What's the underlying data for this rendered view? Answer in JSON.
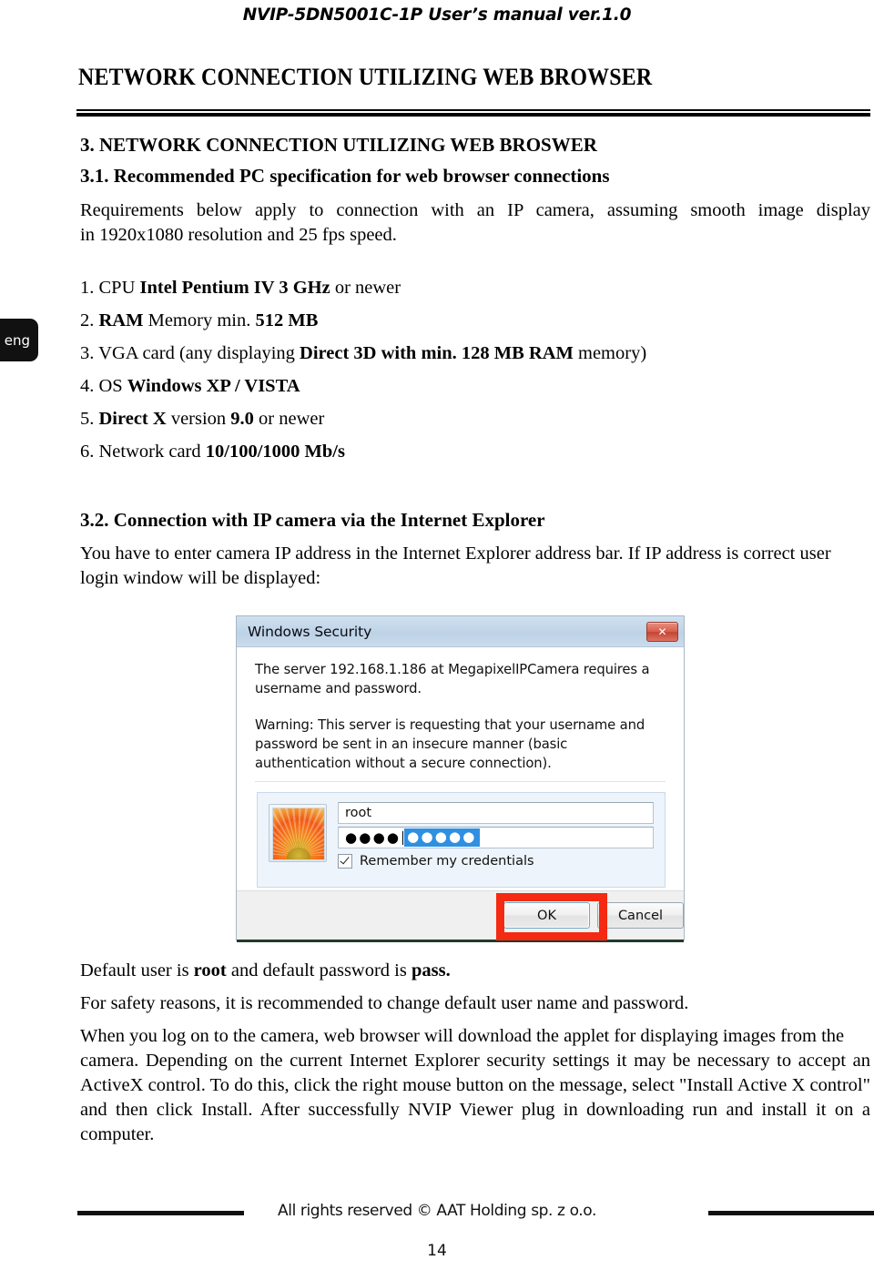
{
  "header": {
    "running_title": "NVIP-5DN5001C-1P User’s manual ver.1.0"
  },
  "chapter": {
    "title": "NETWORK CONNECTION UTILIZING WEB BROWSER"
  },
  "side_tab": {
    "label": "eng"
  },
  "sections": {
    "s3_heading": "3. NETWORK CONNECTION UTILIZING WEB BROSWER",
    "s31_heading": "3.1. Recommended PC specification for web browser connections",
    "s31_intro_1": "Requirements below apply to connection with an IP camera, assuming smooth image display",
    "s31_intro_2": "in  1920x1080 resolution and 25 fps speed.",
    "s32_heading": "3.2. Connection with IP camera via the Internet Explorer",
    "s32_intro_1": "You have to enter camera IP address in the Internet Explorer address bar. If IP address is correct user",
    "s32_intro_2": "login window will be displayed:"
  },
  "requirements": [
    {
      "num": "1.",
      "pre": "CPU ",
      "bold": "Intel Pentium IV 3 GHz",
      "post": " or newer"
    },
    {
      "num": "2.",
      "pre": "",
      "bold": "RAM",
      "mid": " Memory min. ",
      "bold2": "512 MB",
      "post": ""
    },
    {
      "num": "3.",
      "pre": "VGA card (any displaying ",
      "bold": "Direct 3D with min. 128 MB RAM",
      "post": " memory)"
    },
    {
      "num": "4.",
      "pre": "OS ",
      "bold": "Windows XP / VISTA",
      "post": ""
    },
    {
      "num": "5.",
      "pre": "",
      "bold": "Direct X",
      "mid": " version ",
      "bold2": "9.0",
      "post": " or newer"
    },
    {
      "num": "6.",
      "pre": "Network card ",
      "bold": "10/100/1000 Mb/s",
      "post": ""
    }
  ],
  "dialog": {
    "title": "Windows Security",
    "close_label": "✖",
    "para1": "The server 192.168.1.186 at MegapixelIPCamera requires a username and password.",
    "para2": "Warning: This server is requesting that your username and password be sent in an insecure manner (basic authentication without a secure connection).",
    "username_value": "root",
    "password_dots": "●●●●",
    "password_selected_dots": "●●●●●",
    "remember_label": "Remember my credentials",
    "ok_label": "OK",
    "cancel_label": "Cancel",
    "highlight_color": "#f42a12"
  },
  "notes": {
    "note1_pre": "Default user is ",
    "note1_bold1": "root",
    "note1_mid": " and default password is ",
    "note1_bold2": "pass.",
    "note2": "For safety reasons, it is recommended to change default user name and password.",
    "note3_line1": "When you log on to the camera, web browser will download the applet for displaying images from the",
    "note3_rest": "camera. Depending on the current Internet Explorer security settings it may be necessary to accept an ActiveX control. To do this, click the right mouse button on the message, select \"Install Active X control\" and then click Install. After successfully NVIP Viewer plug in downloading run and install it on a computer."
  },
  "footer": {
    "copyright": "All rights reserved © AAT Holding sp. z o.o.",
    "page_number": "14"
  }
}
